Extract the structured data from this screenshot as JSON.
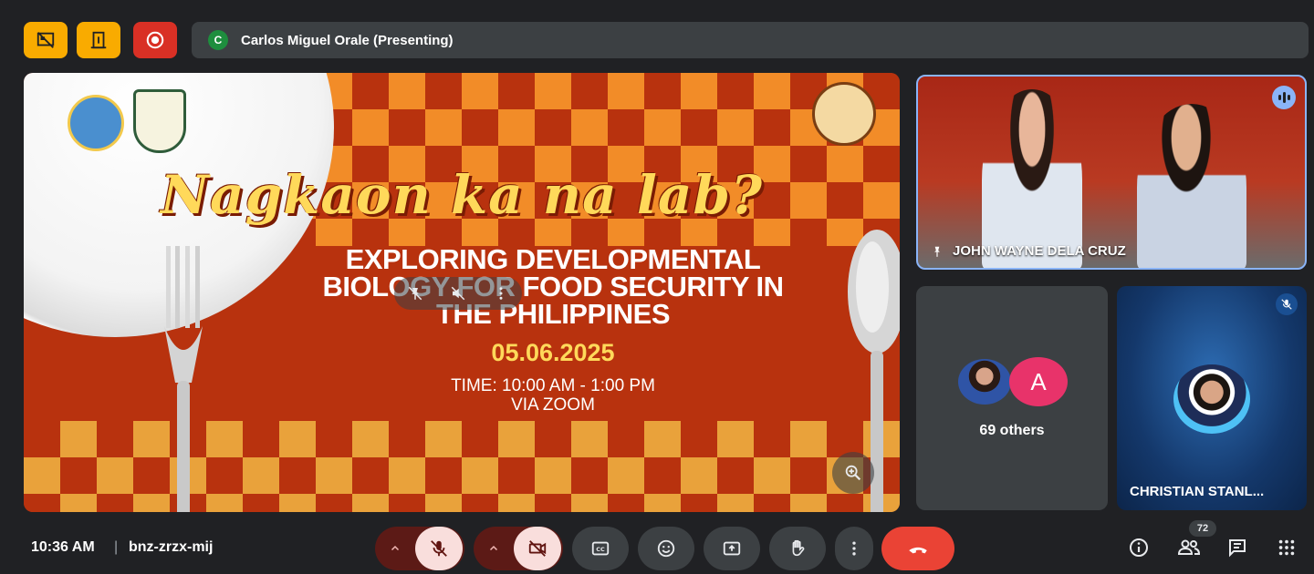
{
  "top_bar": {
    "presenter_initial": "C",
    "presenter_text": "Carlos Miguel Orale (Presenting)",
    "buttons": [
      {
        "icon": "hide-tiles-icon",
        "color": "#f9ab00"
      },
      {
        "icon": "exit-door-icon",
        "color": "#f9ab00"
      },
      {
        "icon": "record-icon",
        "color": "#d93025"
      }
    ]
  },
  "slide": {
    "title": "Nagkaon ka na lab?",
    "subtitle_line1": "EXPLORING DEVELOPMENTAL",
    "subtitle_line2": "BIOLOGY FOR FOOD SECURITY IN",
    "subtitle_line3": "THE PHILIPPINES",
    "date": "05.06.2025",
    "time": "TIME: 10:00 AM - 1:00 PM",
    "via": "VIA ZOOM",
    "colors": {
      "background": "#b8320e",
      "checker": "#f28c28",
      "title": "#ffd95a"
    }
  },
  "tiles": {
    "speaker_name": "JOHN WAYNE DELA CRUZ",
    "others_letter": "A",
    "others_label": "69 others",
    "muted_participant_name": "CHRISTIAN STANL..."
  },
  "bottom_bar": {
    "time": "10:36 AM",
    "separator": "|",
    "meeting_code": "bnz-zrzx-mij",
    "participant_count": "72",
    "end_call_color": "#ea4335"
  }
}
